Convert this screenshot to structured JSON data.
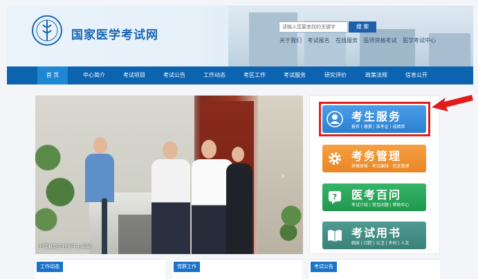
{
  "header": {
    "site_title": "国家医学考试网",
    "search_placeholder": "请输入您要查找的关键字",
    "search_button": "搜 索",
    "quick_links": [
      "关于我们",
      "考试报名",
      "在线服务",
      "医师资格考试",
      "医学考试中心"
    ]
  },
  "nav": {
    "items": [
      "首 页",
      "中心简介",
      "考试项目",
      "考试公告",
      "工作动态",
      "考区工作",
      "考试服务",
      "研究评价",
      "政策法规",
      "信息公开"
    ],
    "active_index": 0
  },
  "banner": {
    "caption": "王雪凝副主任到中心调研"
  },
  "services": [
    {
      "title": "考生服务",
      "sub": "报名 | 缴费 | 准考证 | 成绩单",
      "icon": "user-icon",
      "color": "#2b7fd0"
    },
    {
      "title": "考务管理",
      "sub": "资格审核 · 考试编排 · 信息管理",
      "icon": "gear-icon",
      "color": "#ea8625"
    },
    {
      "title": "医考百问",
      "sub": "考试介绍 | 常见问题 | 帮助中心",
      "icon": "chat-icon",
      "color": "#20984f"
    },
    {
      "title": "考试用书",
      "sub": "临床 | 口腔 | 公卫 | 乡村 | 人文",
      "icon": "book-icon",
      "color": "#3a8178"
    }
  ],
  "bottom_tabs": [
    "工作动态",
    "党群工作",
    "考试公告"
  ],
  "colors": {
    "nav": "#0c63b0",
    "highlight": "#e31b1b",
    "brand": "#1a66b3"
  }
}
